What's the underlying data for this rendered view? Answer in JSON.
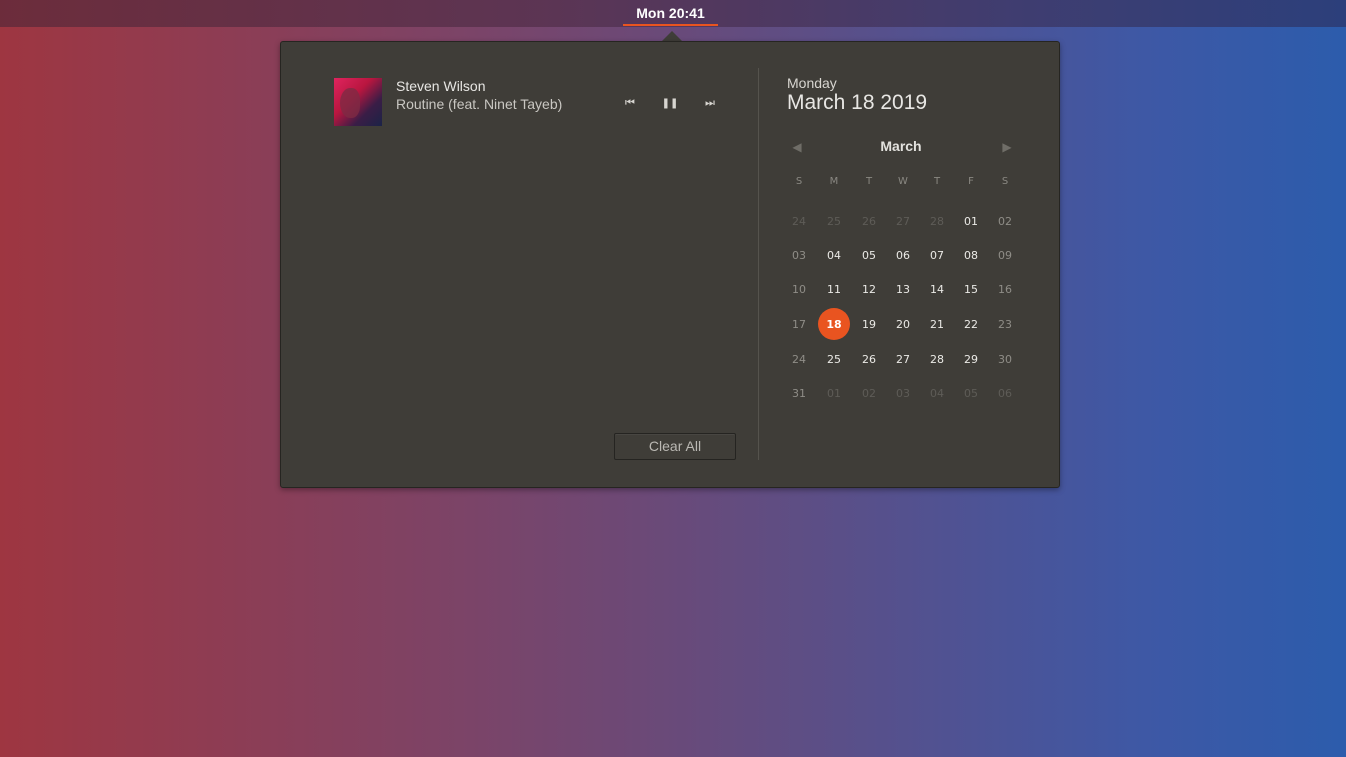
{
  "topbar": {
    "clock": "Mon 20:41"
  },
  "media": {
    "artist": "Steven Wilson",
    "track": "Routine (feat. Ninet Tayeb)",
    "controls": [
      "previous-icon",
      "pause-icon",
      "next-icon"
    ]
  },
  "notifications": {
    "clear_label": "Clear All"
  },
  "calendar": {
    "weekday": "Monday",
    "date": "March 18 2019",
    "month": "March",
    "day_headers": [
      "S",
      "M",
      "T",
      "W",
      "T",
      "F",
      "S"
    ],
    "weeks": [
      [
        "24",
        "25",
        "26",
        "27",
        "28",
        "01",
        "02"
      ],
      [
        "03",
        "04",
        "05",
        "06",
        "07",
        "08",
        "09"
      ],
      [
        "10",
        "11",
        "12",
        "13",
        "14",
        "15",
        "16"
      ],
      [
        "17",
        "18",
        "19",
        "20",
        "21",
        "22",
        "23"
      ],
      [
        "24",
        "25",
        "26",
        "27",
        "28",
        "29",
        "30"
      ],
      [
        "31",
        "01",
        "02",
        "03",
        "04",
        "05",
        "06"
      ]
    ],
    "today": "18",
    "accent_color": "#e95420"
  }
}
